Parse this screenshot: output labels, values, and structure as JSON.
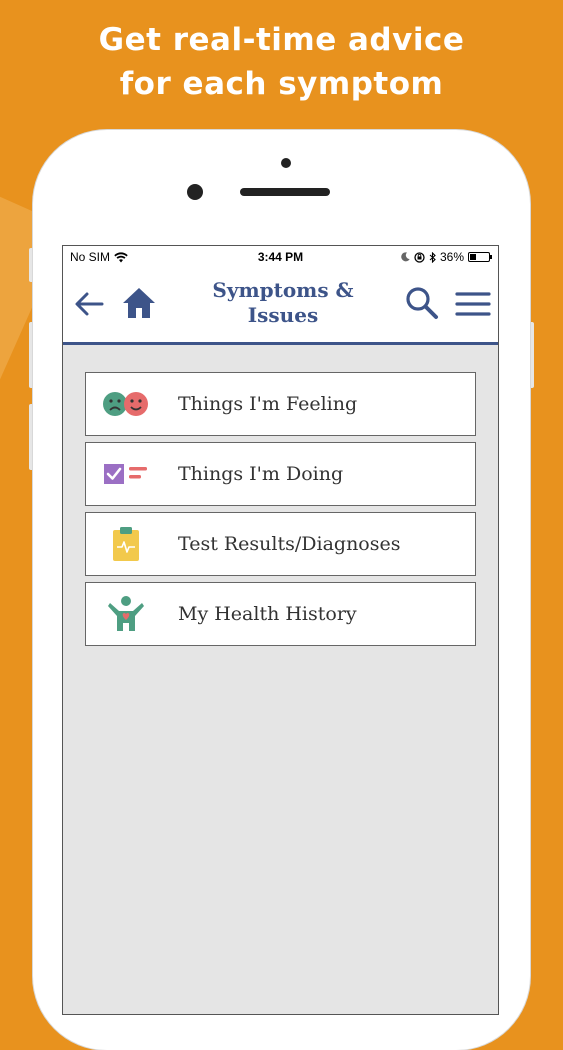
{
  "promo": {
    "headline_line1": "Get real-time advice",
    "headline_line2": "for each symptom"
  },
  "status_bar": {
    "carrier": "No SIM",
    "time": "3:44 PM",
    "battery_percent": "36%",
    "battery_level": 0.36
  },
  "nav": {
    "title_line1": "Symptoms &",
    "title_line2": "Issues",
    "back_icon": "arrow-left-icon",
    "home_icon": "home-icon",
    "search_icon": "search-icon",
    "menu_icon": "hamburger-menu-icon"
  },
  "menu_items": [
    {
      "label": "Things I'm Feeling",
      "icon": "feelings-faces-icon"
    },
    {
      "label": "Things I'm Doing",
      "icon": "checklist-icon"
    },
    {
      "label": "Test Results/Diagnoses",
      "icon": "clipboard-icon"
    },
    {
      "label": "My Health History",
      "icon": "person-heart-icon"
    }
  ],
  "colors": {
    "background": "#E8921E",
    "nav_accent": "#3D5489",
    "content_bg": "#E5E5E5"
  }
}
